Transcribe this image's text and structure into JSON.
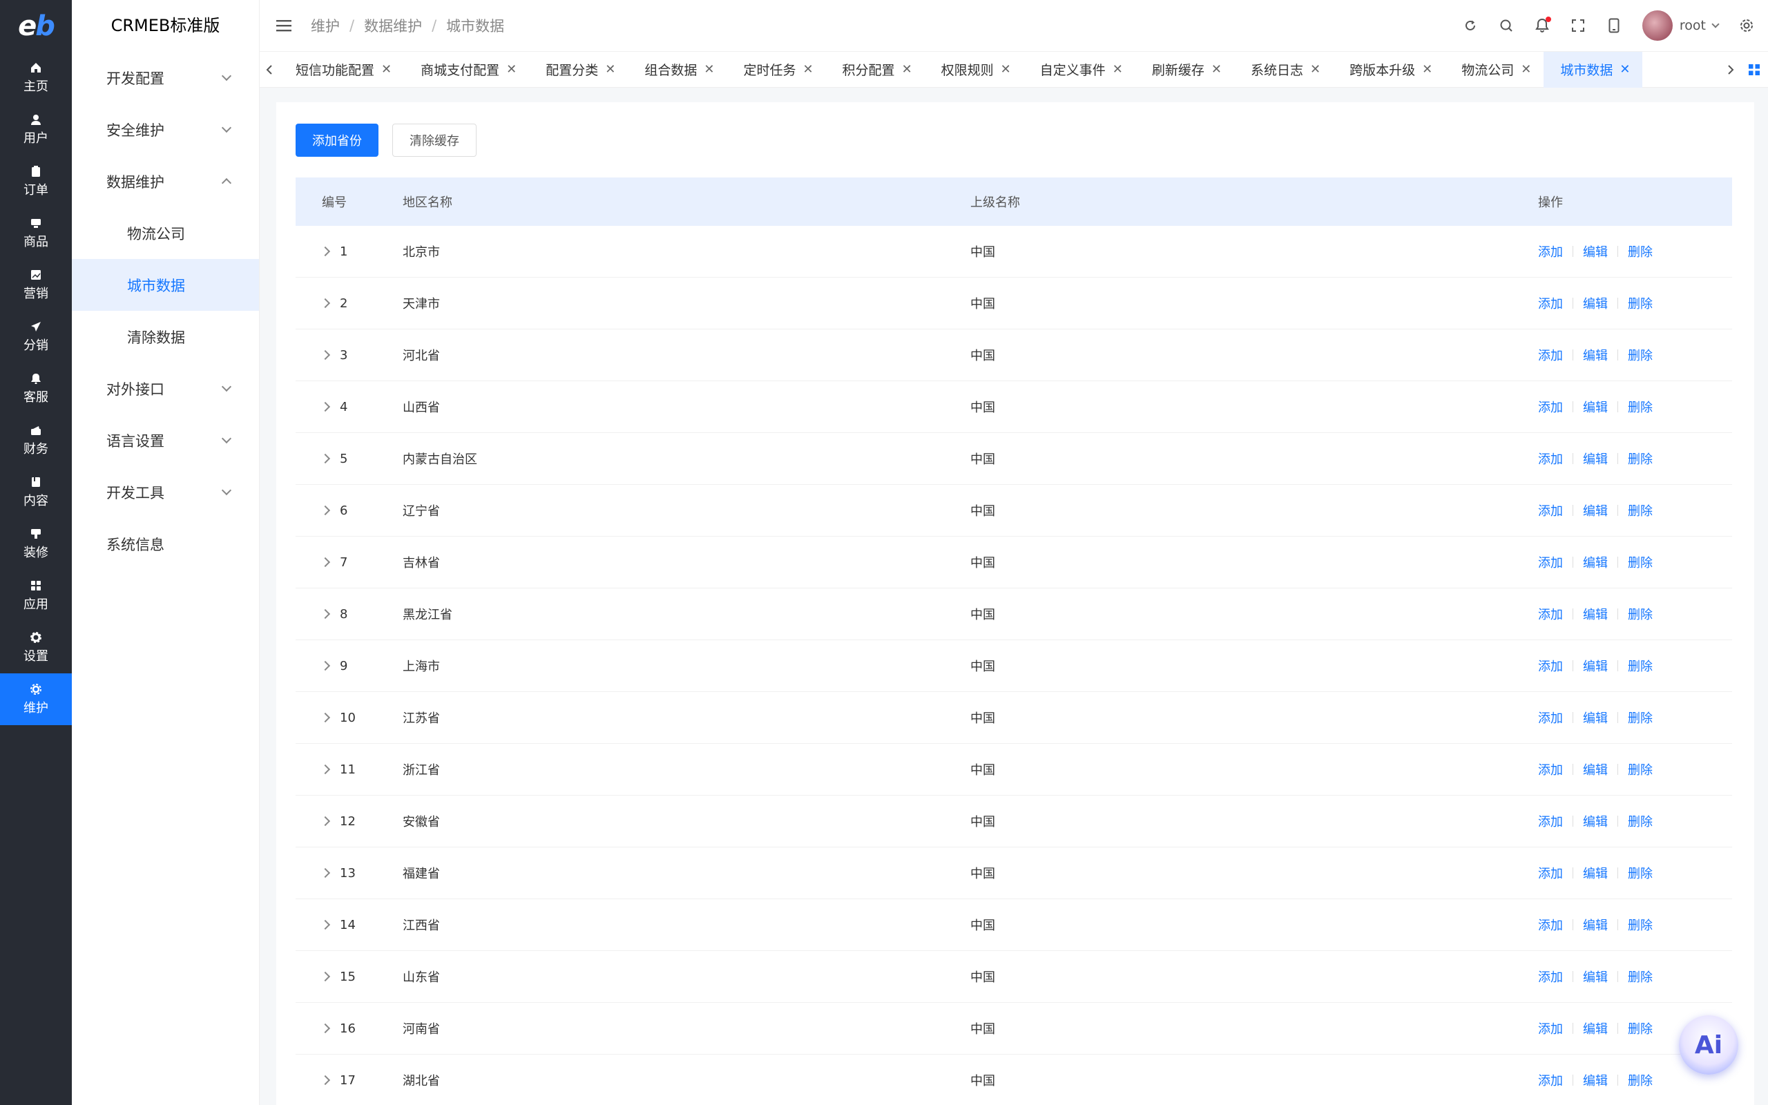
{
  "rail": {
    "logo": "eb",
    "items": [
      {
        "label": "主页",
        "icon": "home-icon"
      },
      {
        "label": "用户",
        "icon": "user-icon"
      },
      {
        "label": "订单",
        "icon": "order-icon"
      },
      {
        "label": "商品",
        "icon": "product-icon"
      },
      {
        "label": "营销",
        "icon": "marketing-icon"
      },
      {
        "label": "分销",
        "icon": "distribution-icon"
      },
      {
        "label": "客服",
        "icon": "service-icon"
      },
      {
        "label": "财务",
        "icon": "finance-icon"
      },
      {
        "label": "内容",
        "icon": "content-icon"
      },
      {
        "label": "装修",
        "icon": "decoration-icon"
      },
      {
        "label": "应用",
        "icon": "apps-icon"
      },
      {
        "label": "设置",
        "icon": "settings-icon"
      },
      {
        "label": "维护",
        "icon": "maintenance-icon"
      }
    ],
    "active_index": 12
  },
  "sidebar": {
    "title": "CRMEB标准版",
    "items": [
      {
        "label": "开发配置",
        "type": "group",
        "expanded": false
      },
      {
        "label": "安全维护",
        "type": "group",
        "expanded": false
      },
      {
        "label": "数据维护",
        "type": "group",
        "expanded": true
      },
      {
        "label": "物流公司",
        "type": "sub"
      },
      {
        "label": "城市数据",
        "type": "sub",
        "active": true
      },
      {
        "label": "清除数据",
        "type": "sub"
      },
      {
        "label": "对外接口",
        "type": "group",
        "expanded": false
      },
      {
        "label": "语言设置",
        "type": "group",
        "expanded": false
      },
      {
        "label": "开发工具",
        "type": "group",
        "expanded": false
      },
      {
        "label": "系统信息",
        "type": "leaf"
      }
    ]
  },
  "header": {
    "breadcrumb": [
      "维护",
      "数据维护",
      "城市数据"
    ],
    "username": "root"
  },
  "tabs": {
    "items": [
      "短信功能配置",
      "商城支付配置",
      "配置分类",
      "组合数据",
      "定时任务",
      "积分配置",
      "权限规则",
      "自定义事件",
      "刷新缓存",
      "系统日志",
      "跨版本升级",
      "物流公司",
      "城市数据"
    ],
    "active_index": 12
  },
  "toolbar": {
    "add_label": "添加省份",
    "clear_label": "清除缓存"
  },
  "table": {
    "headers": {
      "id": "编号",
      "name": "地区名称",
      "parent": "上级名称",
      "op": "操作"
    },
    "actions": {
      "add": "添加",
      "edit": "编辑",
      "delete": "删除"
    },
    "rows": [
      {
        "id": "1",
        "name": "北京市",
        "parent": "中国"
      },
      {
        "id": "2",
        "name": "天津市",
        "parent": "中国"
      },
      {
        "id": "3",
        "name": "河北省",
        "parent": "中国"
      },
      {
        "id": "4",
        "name": "山西省",
        "parent": "中国"
      },
      {
        "id": "5",
        "name": "内蒙古自治区",
        "parent": "中国"
      },
      {
        "id": "6",
        "name": "辽宁省",
        "parent": "中国"
      },
      {
        "id": "7",
        "name": "吉林省",
        "parent": "中国"
      },
      {
        "id": "8",
        "name": "黑龙江省",
        "parent": "中国"
      },
      {
        "id": "9",
        "name": "上海市",
        "parent": "中国"
      },
      {
        "id": "10",
        "name": "江苏省",
        "parent": "中国"
      },
      {
        "id": "11",
        "name": "浙江省",
        "parent": "中国"
      },
      {
        "id": "12",
        "name": "安徽省",
        "parent": "中国"
      },
      {
        "id": "13",
        "name": "福建省",
        "parent": "中国"
      },
      {
        "id": "14",
        "name": "江西省",
        "parent": "中国"
      },
      {
        "id": "15",
        "name": "山东省",
        "parent": "中国"
      },
      {
        "id": "16",
        "name": "河南省",
        "parent": "中国"
      },
      {
        "id": "17",
        "name": "湖北省",
        "parent": "中国"
      }
    ]
  },
  "ai_button": {
    "label": "Ai"
  },
  "colors": {
    "accent": "#1677ff",
    "rail_bg": "#282c34",
    "header_row_bg": "#e8f0fe"
  }
}
